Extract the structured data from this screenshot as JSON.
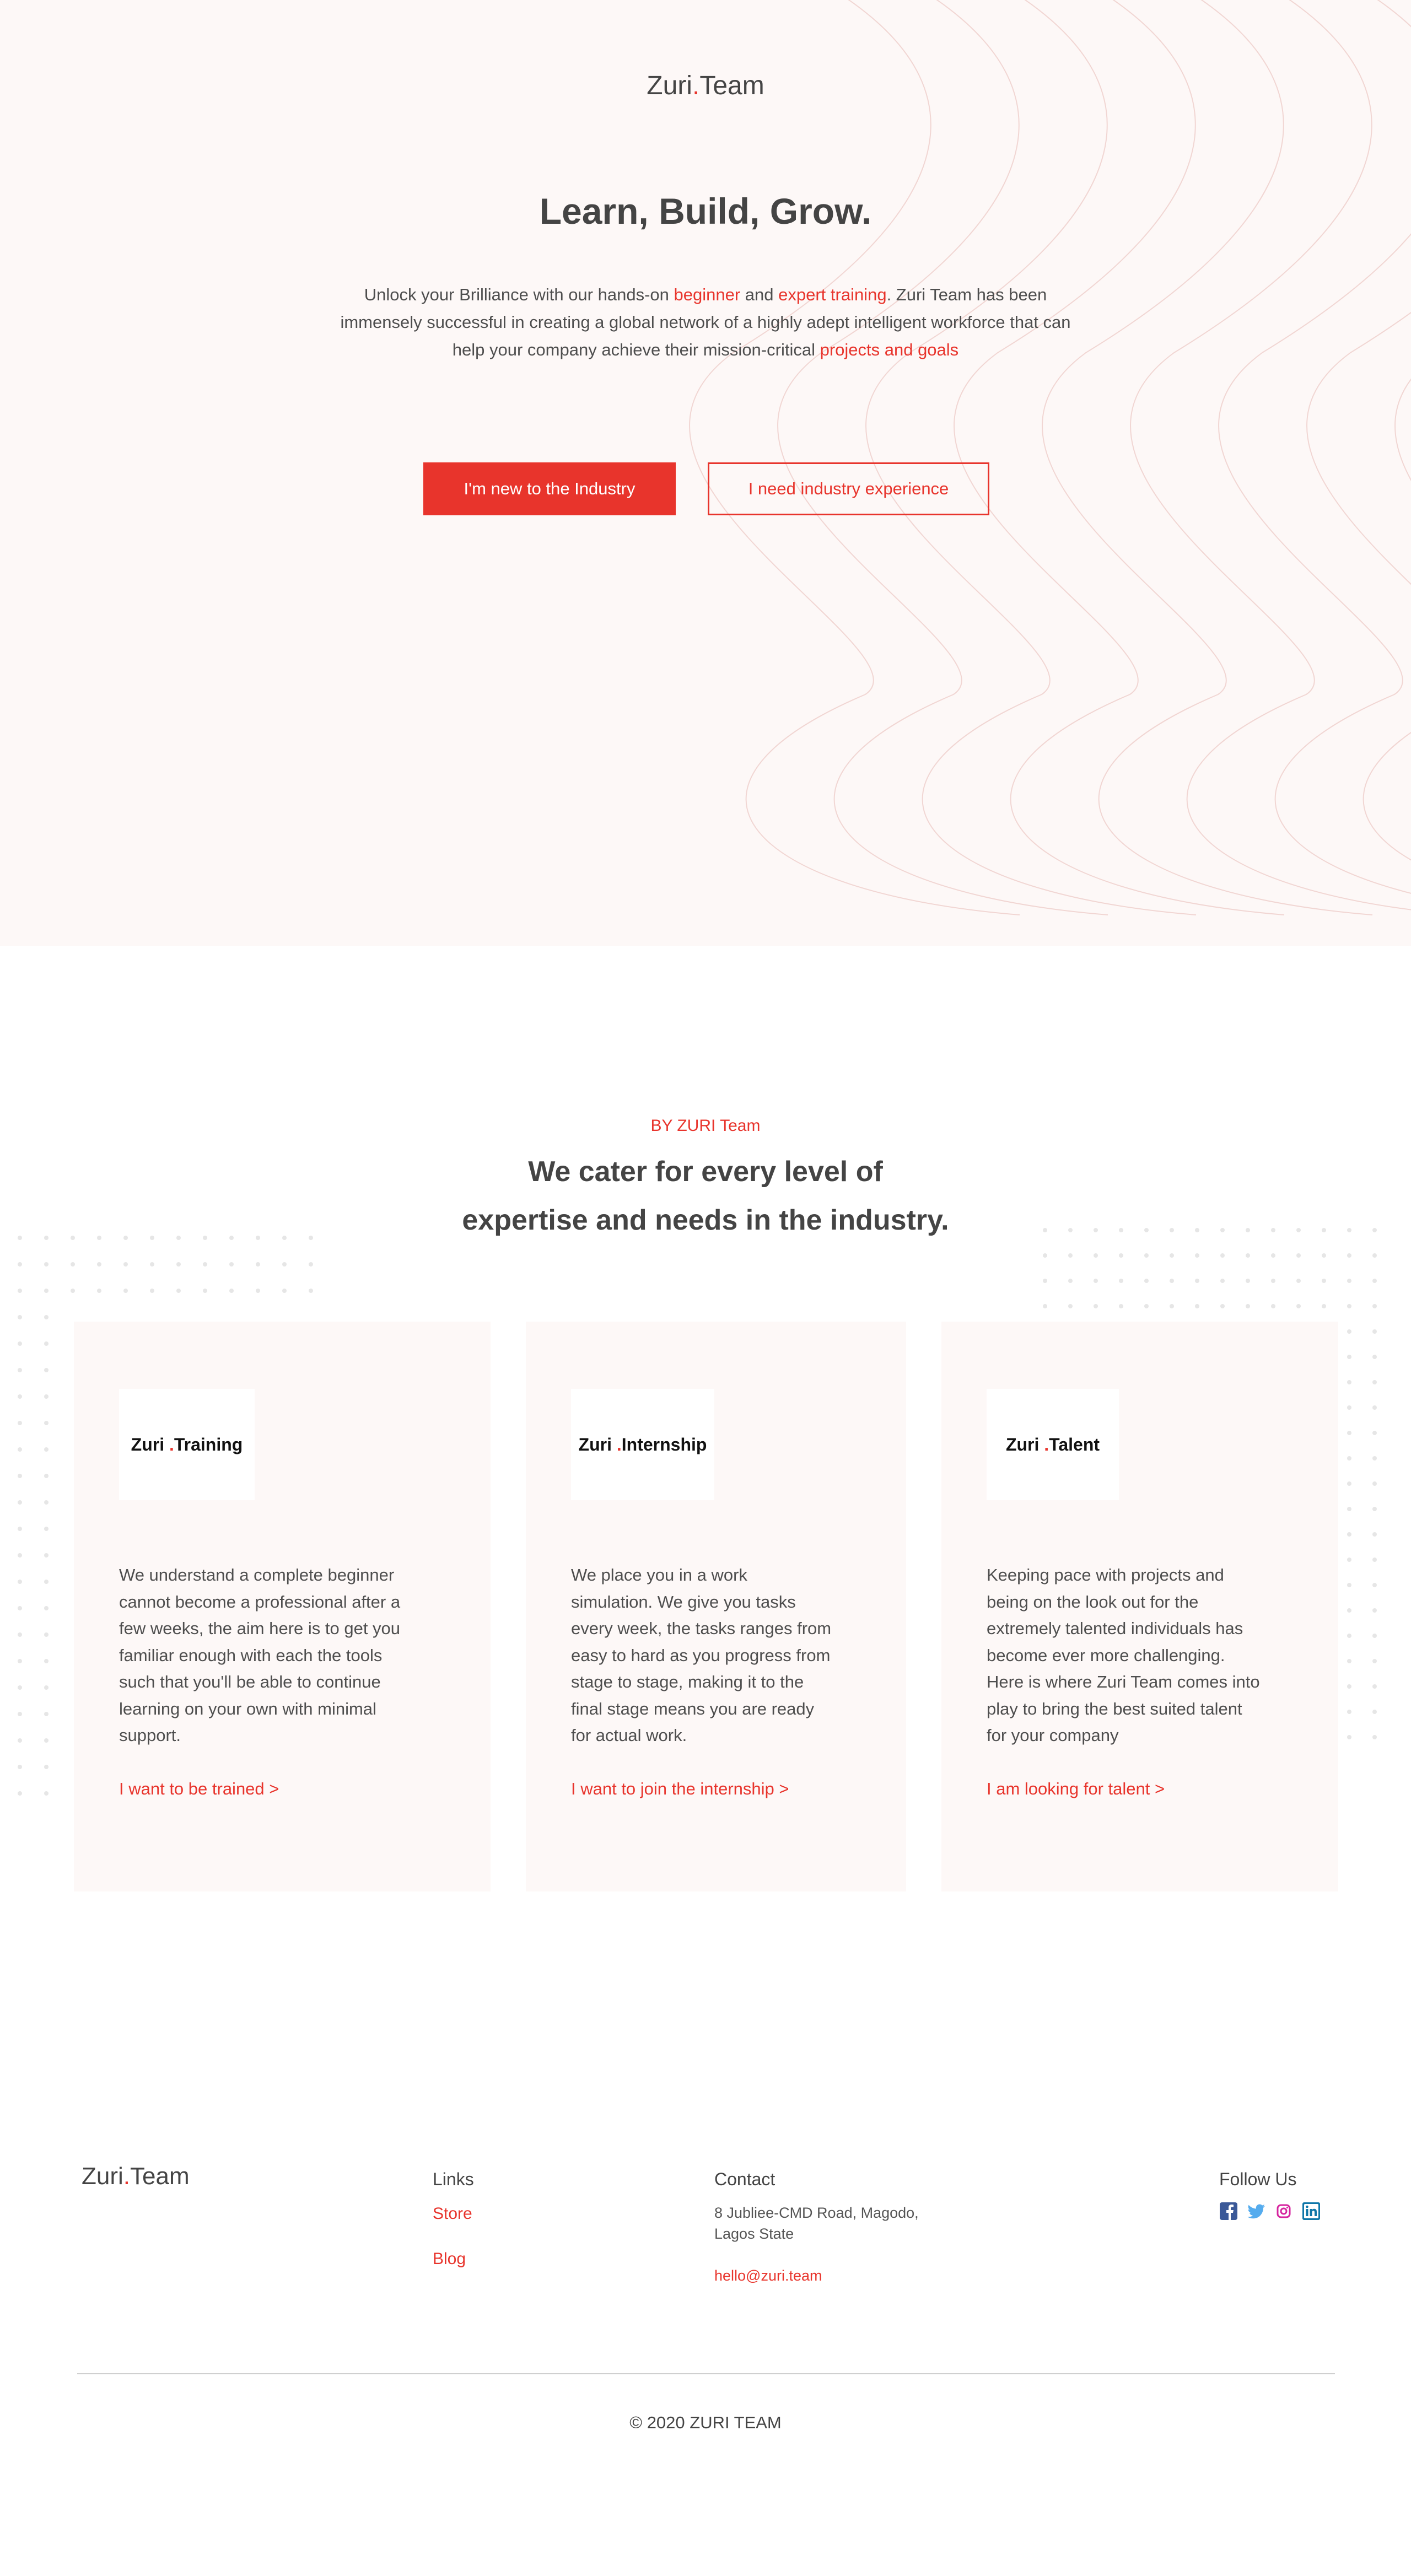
{
  "brand": {
    "name_part1": "Zuri",
    "dot": ".",
    "name_part2": "Team"
  },
  "hero": {
    "title": "Learn, Build, Grow.",
    "desc_1": "Unlock your Brilliance with our hands-on ",
    "desc_link_beginner": "beginner",
    "desc_and": " and ",
    "desc_link_expert": "expert training",
    "desc_2": ". Zuri Team has been immensely successful in creating a global network of a highly adept intelligent workforce that can help your company achieve their mission-critical ",
    "desc_link_projects": "projects and goals",
    "primary_button": "I'm new to the Industry",
    "secondary_button": "I need industry experience"
  },
  "services": {
    "kicker": "BY ZURI Team",
    "headline_line1": "We cater for every level of",
    "headline_line2": "expertise and needs in the industry.",
    "cards": [
      {
        "logo_left": "Zuri",
        "logo_dot": ".",
        "logo_right": "Training",
        "lines": [
          "We understand a complete beginner",
          "cannot become a professional after a",
          "few weeks, the aim here is to get you",
          "familiar enough with each the tools",
          "such that you'll be able to continue",
          "learning on your own with minimal",
          "support."
        ],
        "link": "I want to be trained >"
      },
      {
        "logo_left": "Zuri",
        "logo_dot": ".",
        "logo_right": "Internship",
        "lines": [
          "We place you in a work",
          "simulation. We give you tasks",
          "every week, the tasks ranges from",
          "easy to hard as you progress from",
          "stage to stage, making it to the",
          "final stage means you are ready",
          "for actual work."
        ],
        "link": "I want to join the internship >"
      },
      {
        "logo_left": "Zuri",
        "logo_dot": ".",
        "logo_right": "Talent",
        "lines": [
          "Keeping pace with projects and",
          "being on the look out for the",
          "extremely talented individuals has",
          "become ever more challenging.",
          "Here is where Zuri Team comes into",
          "play to bring the best suited talent",
          "for your company"
        ],
        "link": "I am looking for talent >"
      }
    ]
  },
  "footer": {
    "links_heading": "Links",
    "links": [
      "Store",
      "Blog"
    ],
    "contact_heading": "Contact",
    "address_line1": "8 Jubliee-CMD Road, Magodo,",
    "address_line2": "Lagos State",
    "email": "hello@zuri.team",
    "follow_heading": "Follow Us",
    "social_icons": [
      "facebook-icon",
      "twitter-icon",
      "instagram-icon",
      "linkedin-icon"
    ],
    "copyright": "© 2020 ZURI TEAM"
  },
  "colors": {
    "accent": "#e8342c",
    "hero_bg": "#fdf8f7",
    "card_bg": "#fdf8f7",
    "facebook": "#3b5998",
    "twitter": "#55acee",
    "instagram": "#d6249f",
    "linkedin": "#0e76a8"
  }
}
